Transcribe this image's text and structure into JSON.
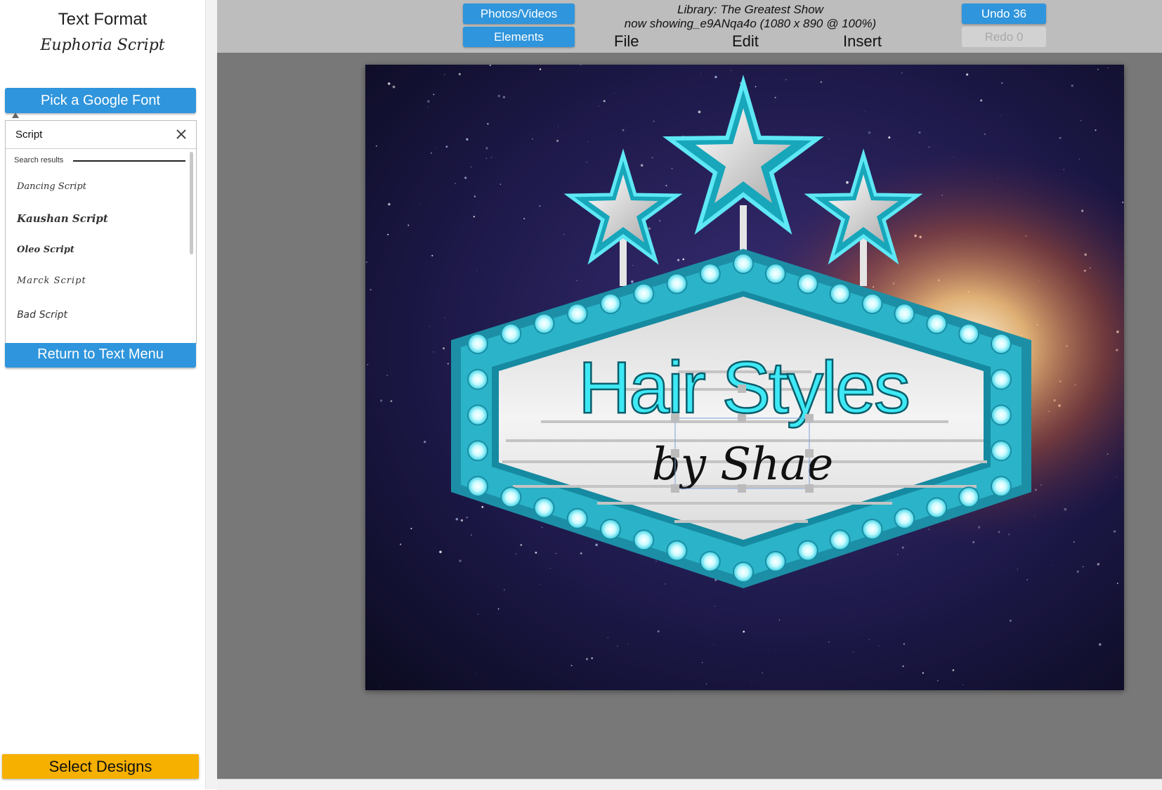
{
  "sidebar": {
    "title": "Text Format",
    "current_font": "Euphoria Script",
    "pick_button": "Pick a Google Font",
    "search_value": "Script",
    "results_header": "Search results",
    "fonts": [
      "Dancing Script",
      "Kaushan Script",
      "Oleo Script",
      "Marck Script",
      "Bad Script"
    ],
    "return_button": "Return to Text Menu",
    "select_designs": "Select Designs"
  },
  "topbar": {
    "photos_button": "Photos/Videos",
    "elements_button": "Elements",
    "library_title": "Library: The Greatest Show",
    "now_showing": "now showing_e9ANqa4o  (1080 x 890 @ 100%)",
    "menu": [
      "File",
      "Edit",
      "Insert"
    ],
    "undo_button": "Undo 36",
    "redo_button": "Redo 0"
  },
  "canvas": {
    "headline": "Hair Styles",
    "subline": "by Shae",
    "colors": {
      "sign_teal": "#2bb3c9",
      "headline": "#3ee9f5",
      "subline": "#111111",
      "space": "#1a1640"
    }
  }
}
